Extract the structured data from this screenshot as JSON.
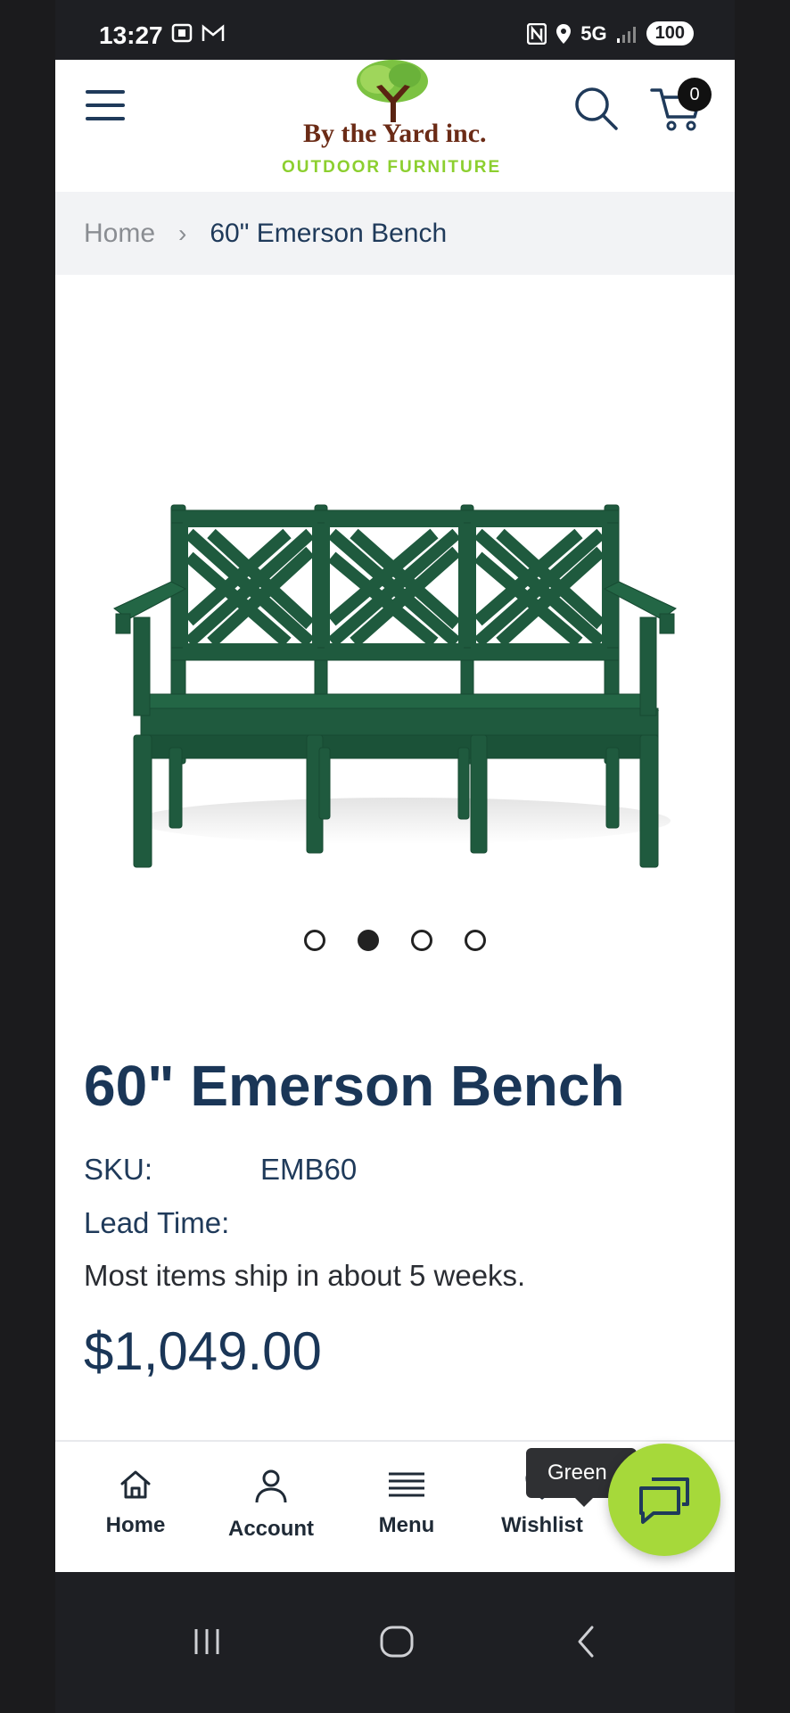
{
  "status_bar": {
    "time": "13:27",
    "network": "5G",
    "battery": "100"
  },
  "header": {
    "brand": "By the Yard inc.",
    "brand_subtitle": "OUTDOOR FURNITURE",
    "cart_count": "0"
  },
  "breadcrumb": {
    "home": "Home",
    "separator": "›",
    "current": "60\" Emerson Bench"
  },
  "carousel": {
    "slide_count": 4,
    "active_index": 1
  },
  "product": {
    "title": "60\" Emerson Bench",
    "sku_label": "SKU:",
    "sku_value": "EMB60",
    "lead_time_label": "Lead Time:",
    "lead_time_text": "Most items ship in about 5 weeks.",
    "price": "$1,049.00",
    "color": "#1f5a3e"
  },
  "bottom_nav": {
    "items": [
      {
        "label": "Home",
        "icon": "home-icon"
      },
      {
        "label": "Account",
        "icon": "user-icon"
      },
      {
        "label": "Menu",
        "icon": "menu-icon"
      },
      {
        "label": "Wishlist",
        "icon": "heart-icon"
      }
    ],
    "tooltip": "Green"
  },
  "colors": {
    "primary_text": "#1a3657",
    "accent_green": "#a6d93a",
    "logo_brown": "#6b2b16"
  }
}
